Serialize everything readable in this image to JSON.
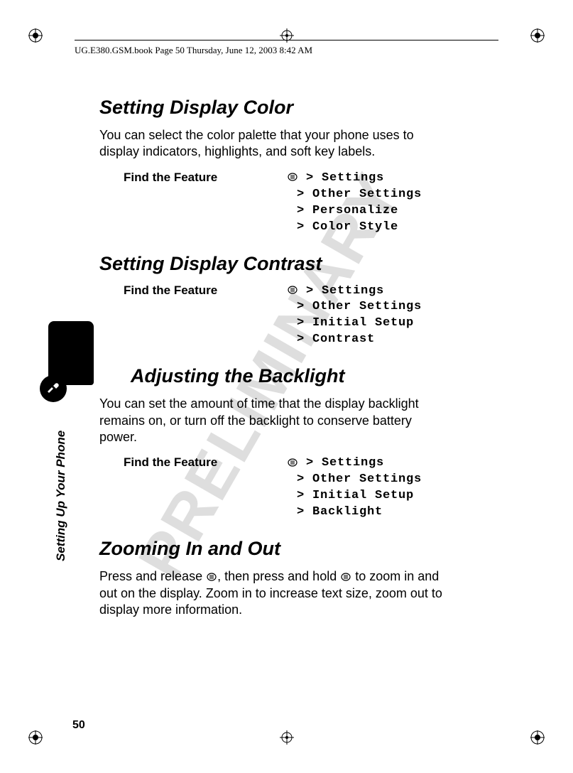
{
  "header": "UG.E380.GSM.book  Page 50  Thursday, June 12, 2003  8:42 AM",
  "watermark": "PRELIMINARY",
  "side_label": "Setting Up Your Phone",
  "page_number": "50",
  "sections": {
    "color": {
      "title": "Setting Display Color",
      "body": "You can select the color palette that your phone uses to display indicators, highlights, and soft key labels.",
      "feature_label": "Find the Feature",
      "path": [
        "Settings",
        "Other Settings",
        "Personalize",
        "Color Style"
      ]
    },
    "contrast": {
      "title": "Setting Display Contrast",
      "feature_label": "Find the Feature",
      "path": [
        "Settings",
        "Other Settings",
        "Initial Setup",
        "Contrast"
      ]
    },
    "backlight": {
      "title": "Adjusting the Backlight",
      "body": "You can set the amount of time that the display backlight remains on, or turn off the backlight to conserve battery power.",
      "feature_label": "Find the Feature",
      "path": [
        "Settings",
        "Other Settings",
        "Initial Setup",
        "Backlight"
      ]
    },
    "zoom": {
      "title": "Zooming In and Out",
      "body_parts": {
        "a": "Press and release ",
        "b": ", then press and hold ",
        "c": " to zoom in and out on the display. Zoom in to increase text size, zoom out to display more information."
      }
    }
  }
}
